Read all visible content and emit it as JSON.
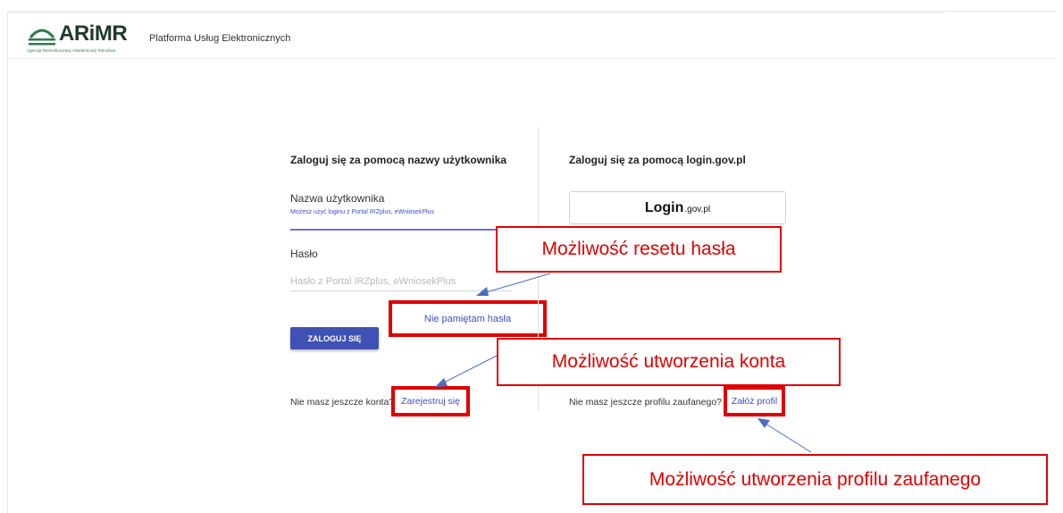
{
  "header": {
    "logo_text": "ARiMR",
    "logo_subtitle": "Agencja Restrukturyzacji i Modernizacji Rolnictwa",
    "platform_title": "Platforma Usług Elektronicznych"
  },
  "left": {
    "heading": "Zaloguj się za pomocą nazwy użytkownika",
    "username_label": "Nazwa użytkownika",
    "username_hint": "Możesz użyć loginu z Portal IRZplus, eWniosekPlus",
    "password_label": "Hasło",
    "password_placeholder": "Hasło z Portal IRZplus, eWniosekPlus",
    "forgot_link": "Nie pamiętam hasła",
    "login_button": "ZALOGUJ SIĘ",
    "register_prompt": "Nie masz jeszcze konta?",
    "register_link": "Zarejestruj się"
  },
  "right": {
    "heading": "Zaloguj się za pomocą login.gov.pl",
    "gov_logo_main": "Login",
    "gov_logo_sub": ".gov.pl",
    "profile_prompt": "Nie masz jeszcze profilu zaufanego?",
    "profile_link": "Załóż profil"
  },
  "annotations": {
    "reset": "Możliwość resetu hasła",
    "create_account": "Możliwość utworzenia konta",
    "create_profile": "Możliwość utworzenia profilu zaufanego"
  },
  "colors": {
    "accent": "#3f51b5",
    "link": "#3d4fc4",
    "annotation_red": "#e00000",
    "arrow_blue": "#4a6fbf",
    "logo_green": "#2e7d4a"
  }
}
